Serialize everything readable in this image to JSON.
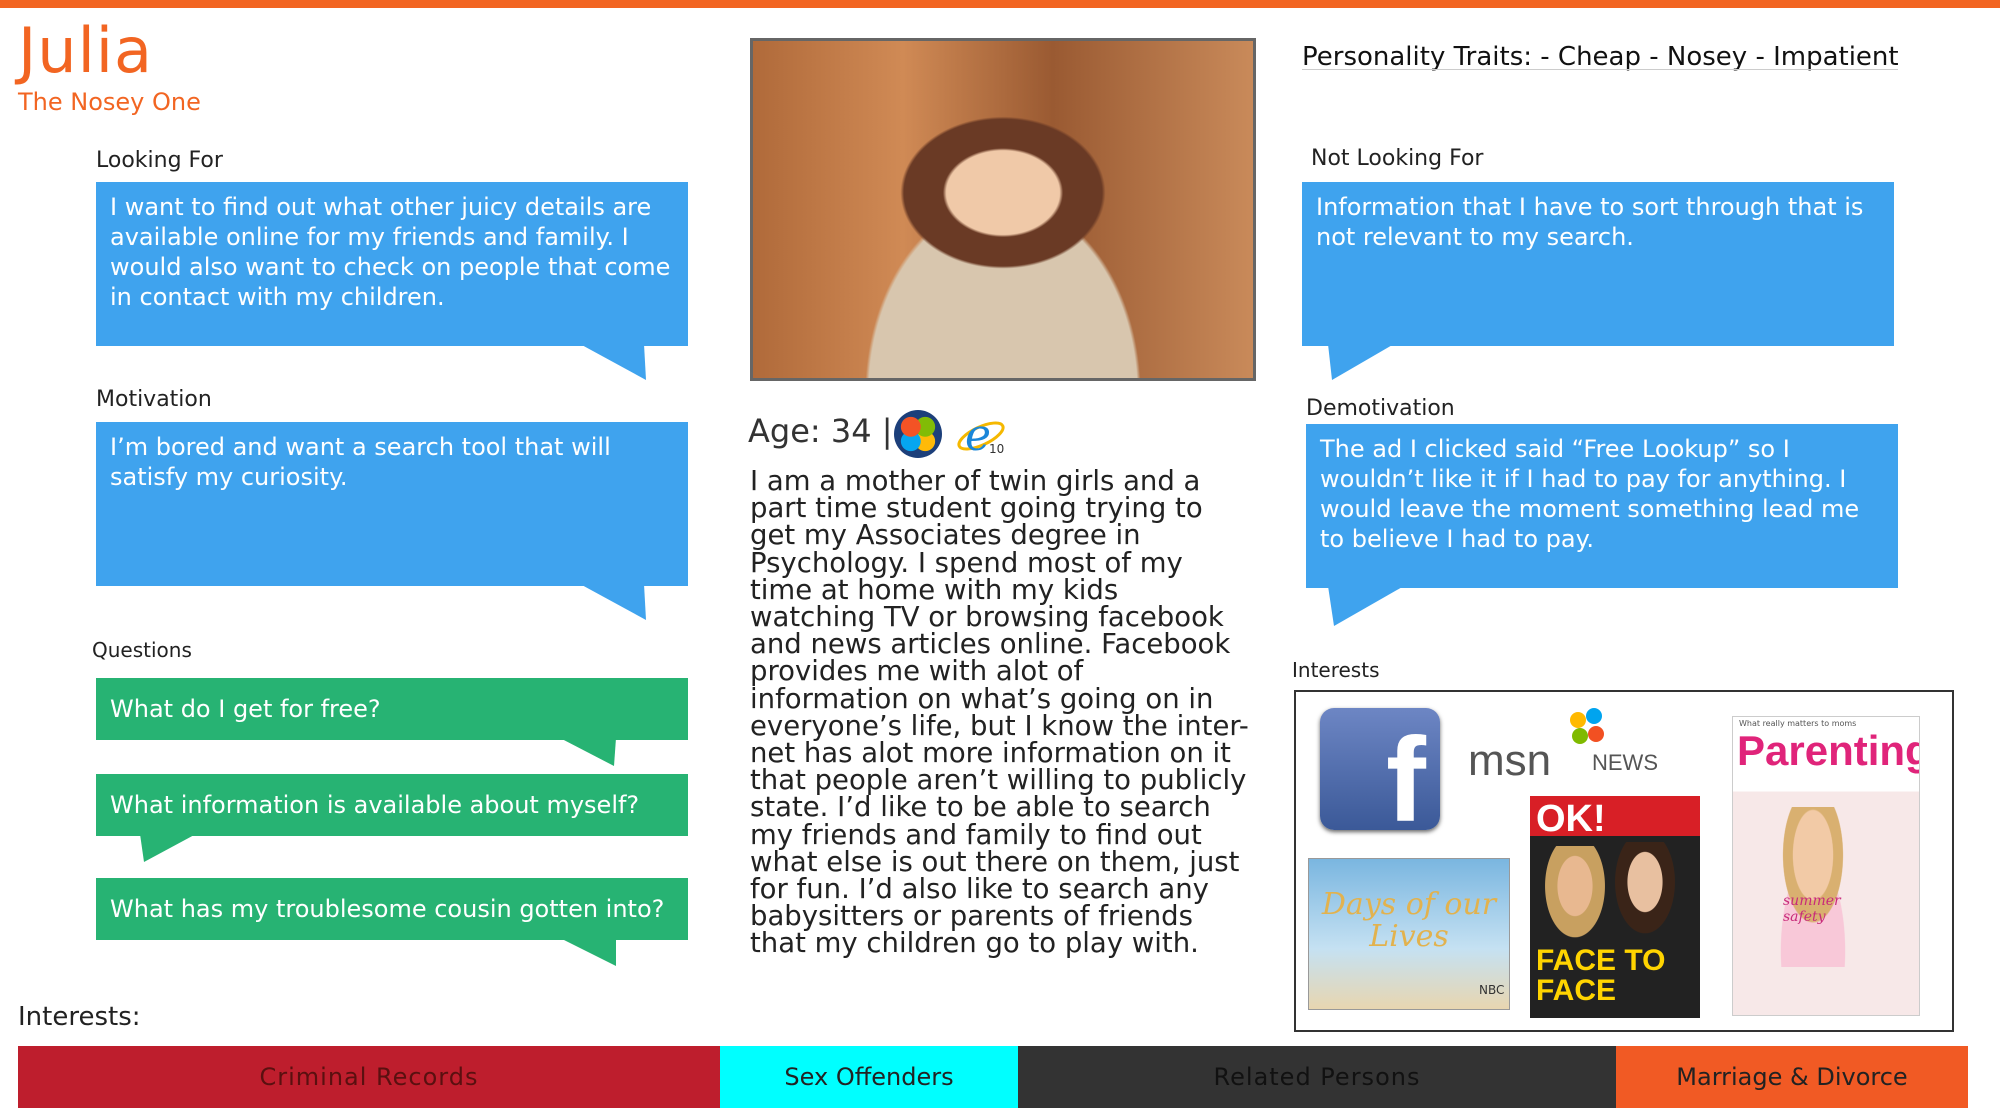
{
  "persona": {
    "name": "Julia",
    "subtitle": "The Nosey One",
    "traits": "Personality Traits: - Cheap - Nosey - Impatient"
  },
  "looking_for": {
    "label": "Looking For",
    "text": "I want to find out what other juicy details are available online for my friends and family. I would also want to check on people that come in contact with my children."
  },
  "motivation": {
    "label": "Motivation",
    "text": "I’m bored and want a search tool that will satisfy my curiosity."
  },
  "questions": {
    "label": "Questions",
    "items": [
      "What do I get for free?",
      "What information is available about myself?",
      "What has my troublesome cousin gotten into?"
    ]
  },
  "not_looking_for": {
    "label": "Not Looking For",
    "text": "Information that I have to sort through that is not relevant to my search."
  },
  "demotivation": {
    "label": "Demotivation",
    "text": "The ad I clicked  said “Free Lookup” so I wouldn’t like it if I had to pay for anything.  I would leave the moment something lead me to believe I had to pay."
  },
  "profile": {
    "age": "Age: 34 |",
    "ie_version": "10",
    "bio": "I am a mother of twin girls and a part time student going trying to get my Associates degree in Psychology. I spend most of my time at home with my kids watching TV or browsing facebook and news articles online. Facebook provides me with alot of information on what’s going on in everyone’s life, but I know the inter- net has alot more information on it that people aren’t willing to publicly state. I’d like to be able to search my friends and family to find out what else is out there on them, just for fun. I’d also like to search any babysitters or parents of friends that my children go to play with."
  },
  "interests_panel": {
    "label": "Interests",
    "logos": {
      "facebook": "f",
      "msn": "msn",
      "msn_news": "NEWS",
      "days": "Days of our Lives",
      "nbc": "NBC",
      "ok": "OK!",
      "ok_headline": "FACE TO FACE",
      "parenting": "Parenting",
      "parenting_small": "What really matters to moms",
      "parenting_cover": "summer safety"
    }
  },
  "bottom": {
    "label": "Interests:",
    "bars": [
      {
        "label": "Criminal Records",
        "color": "#be1e2d",
        "text_color": "#5a1010"
      },
      {
        "label": "Sex Offenders",
        "color": "#00ffff",
        "text_color": "#222222"
      },
      {
        "label": "Related Persons",
        "color": "#333333",
        "text_color": "#111111"
      },
      {
        "label": "Marriage & Divorce",
        "color": "#f15a24",
        "text_color": "#222222"
      }
    ]
  },
  "colors": {
    "accent": "#f26522",
    "bubble_blue": "#3fa3ee",
    "bubble_green": "#27b373"
  }
}
